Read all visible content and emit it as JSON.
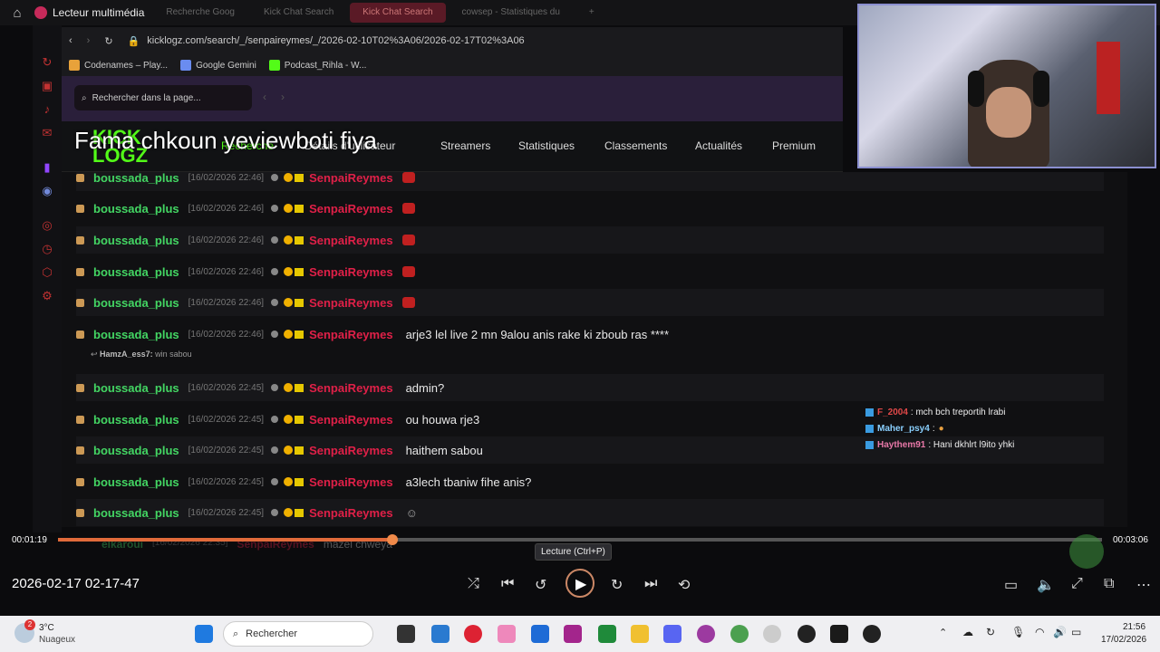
{
  "titlebar": {
    "app_title": "Lecteur multimédia",
    "tabs": [
      "Recherche Goog",
      "Kick Chat Search",
      "Kick Chat Search",
      "cowsep - Statistiques du"
    ]
  },
  "browser": {
    "url": "kicklogz.com/search/_/senpaireymes/_/2026-02-10T02%3A06/2026-02-17T02%3A06",
    "bookmarks": [
      "Codenames – Play...",
      "Google Gemini",
      "Podcast_Rihla - W..."
    ],
    "find_placeholder": "Rechercher dans la page..."
  },
  "site": {
    "logo": "KICK LOGZ",
    "nav": [
      "Recherche",
      "Détails d'utilisateur",
      "Streamers",
      "Statistiques",
      "Classements",
      "Actualités",
      "Premium"
    ]
  },
  "caption": "Fama chkoun yeviewboti fiya",
  "chat": {
    "rows": [
      {
        "user": "boussada_plus",
        "ts": "[16/02/2026 22:46]",
        "streamer": "SenpaiReymes",
        "msg": ""
      },
      {
        "user": "boussada_plus",
        "ts": "[16/02/2026 22:46]",
        "streamer": "SenpaiReymes",
        "msg": ""
      },
      {
        "user": "boussada_plus",
        "ts": "[16/02/2026 22:46]",
        "streamer": "SenpaiReymes",
        "msg": ""
      },
      {
        "user": "boussada_plus",
        "ts": "[16/02/2026 22:46]",
        "streamer": "SenpaiReymes",
        "msg": ""
      },
      {
        "user": "boussada_plus",
        "ts": "[16/02/2026 22:46]",
        "streamer": "SenpaiReymes",
        "msg": ""
      },
      {
        "user": "boussada_plus",
        "ts": "[16/02/2026 22:46]",
        "streamer": "SenpaiReymes",
        "msg": "arje3 lel live 2 mn 9alou anis rake ki zboub ras ****"
      },
      {
        "user": "boussada_plus",
        "ts": "[16/02/2026 22:45]",
        "streamer": "SenpaiReymes",
        "msg": "admin?"
      },
      {
        "user": "boussada_plus",
        "ts": "[16/02/2026 22:45]",
        "streamer": "SenpaiReymes",
        "msg": "ou houwa rje3"
      },
      {
        "user": "boussada_plus",
        "ts": "[16/02/2026 22:45]",
        "streamer": "SenpaiReymes",
        "msg": "haithem sabou"
      },
      {
        "user": "boussada_plus",
        "ts": "[16/02/2026 22:45]",
        "streamer": "SenpaiReymes",
        "msg": "a3lech tbaniw fihe anis?"
      },
      {
        "user": "boussada_plus",
        "ts": "[16/02/2026 22:45]",
        "streamer": "SenpaiReymes",
        "msg": ""
      }
    ],
    "reply": {
      "user": "HamzA_ess7:",
      "text": "win sabou"
    },
    "faded_row": {
      "user": "elkaroui",
      "ts": "[16/02/2026 22:35]",
      "streamer": "SenpaiReymes",
      "msg": "mazel chweya"
    }
  },
  "overlay_chat": [
    {
      "user": "F_2004",
      "text": ": mch bch treportih lrabi",
      "color": "#e04848"
    },
    {
      "user": "Maher_psy4",
      "text": ":",
      "color": "#8ad0ff"
    },
    {
      "user": "Haythem91",
      "text": ": Hani dkhlrt l9ito yhki",
      "color": "#e878a8"
    }
  ],
  "player": {
    "elapsed": "00:01:19",
    "total": "00:03:06",
    "progress_fraction": 0.32,
    "tooltip": "Lecture (Ctrl+P)",
    "timestamp": "2026-02-17 02-17-47"
  },
  "taskbar": {
    "weather_temp": "3°C",
    "weather_desc": "Nuageux",
    "search": "Rechercher",
    "time": "21:56",
    "date": "17/02/2026",
    "badge": "2"
  }
}
